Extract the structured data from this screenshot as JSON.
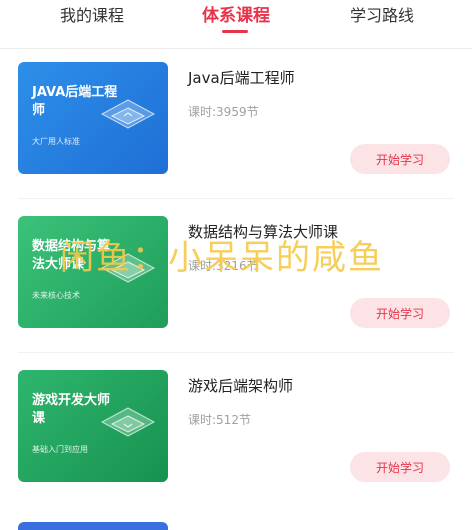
{
  "tabs": [
    {
      "label": "我的课程"
    },
    {
      "label": "体系课程"
    },
    {
      "label": "学习路线"
    }
  ],
  "courses": [
    {
      "thumb_title": "JAVA后端工程师",
      "thumb_sub": "大厂用人标准",
      "title": "Java后端工程师",
      "hours": "课时:3959节",
      "button": "开始学习"
    },
    {
      "thumb_title": "数据结构与算法大师课",
      "thumb_sub": "未来核心技术",
      "title": "数据结构与算法大师课",
      "hours": "课时:3216节",
      "button": "开始学习"
    },
    {
      "thumb_title": "游戏开发大师课",
      "thumb_sub": "基础入门到应用",
      "title": "游戏后端架构师",
      "hours": "课时:512节",
      "button": "开始学习"
    }
  ],
  "watermark": "闲鱼：小呆呆的咸鱼",
  "colors": {
    "accent": "#e8334a",
    "button_bg": "#fbe3e6",
    "watermark": "#f7c948"
  }
}
